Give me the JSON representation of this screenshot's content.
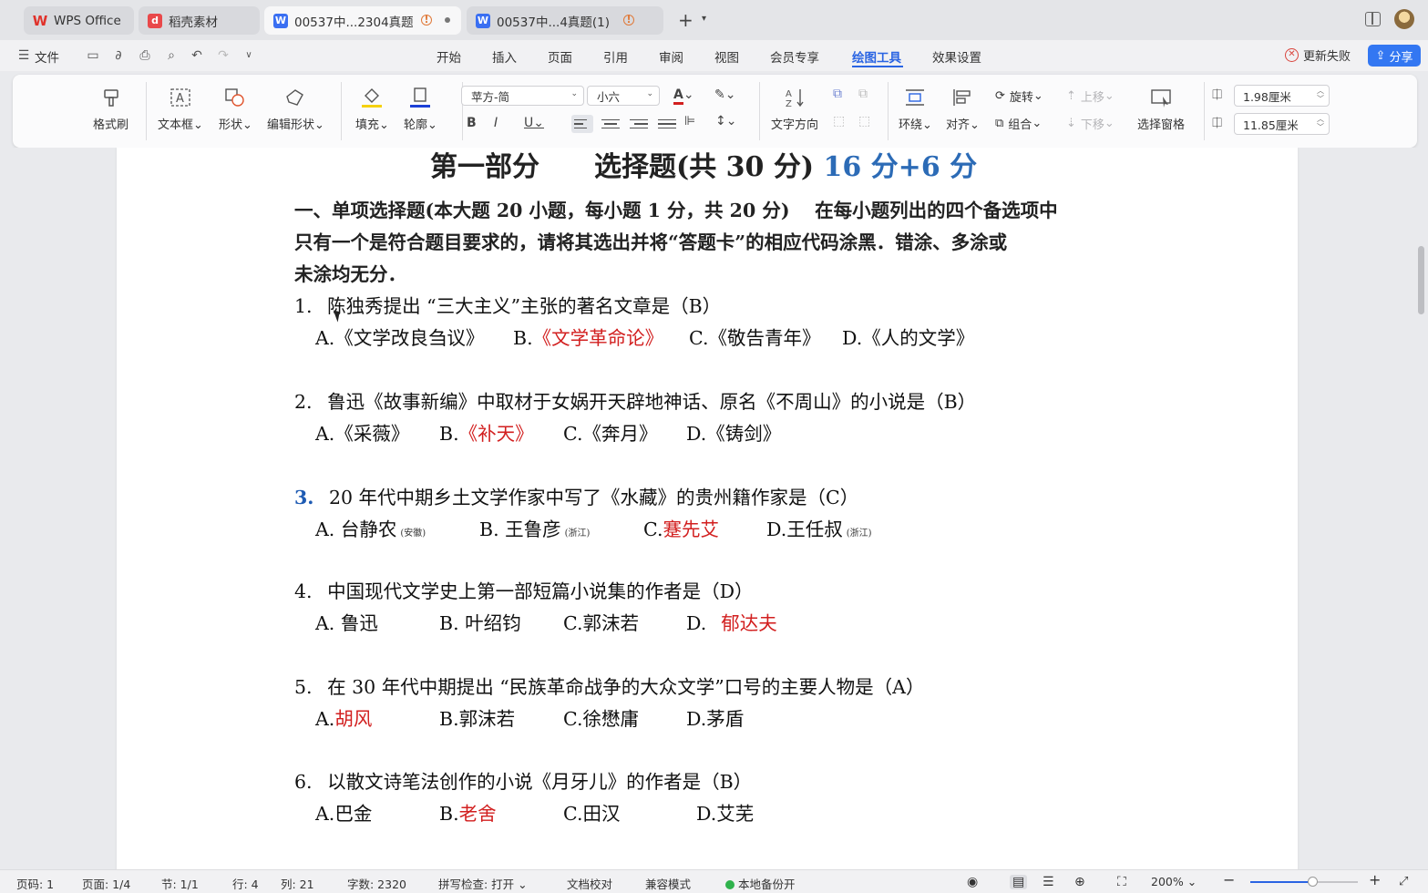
{
  "tabs": [
    {
      "label": "WPS Office",
      "icon": "wps-logo-icon",
      "active": false
    },
    {
      "label": "稻壳素材",
      "icon": "daoke-icon",
      "active": false
    },
    {
      "label": "00537中...2304真题",
      "icon": "word-doc-icon",
      "active": true
    },
    {
      "label": "00537中...4真题(1)",
      "icon": "word-doc-icon",
      "active": false
    }
  ],
  "menubar": {
    "file": "文件",
    "items": [
      "开始",
      "插入",
      "页面",
      "引用",
      "审阅",
      "视图",
      "会员专享",
      "绘图工具",
      "效果设置"
    ],
    "active": "绘图工具",
    "update_status": "更新失败",
    "share": "分享"
  },
  "ribbon": {
    "format_painter": "格式刷",
    "textbox": "文本框",
    "shape": "形状",
    "edit_shape": "编辑形状",
    "fill": "填充",
    "outline": "轮廓",
    "font_name": "苹方-简",
    "font_size": "小六",
    "text_direction": "文字方向",
    "wrap": "环绕",
    "align": "对齐",
    "rotate": "旋转",
    "group": "组合",
    "move_up": "上移",
    "move_down": "下移",
    "selection_pane": "选择窗格",
    "width": "1.98厘米",
    "height": "11.85厘米",
    "colors": {
      "fill_swatch": "#f5d10f",
      "outline_swatch": "#1b3fd6",
      "font_color_swatch": "#d21f1f"
    }
  },
  "document": {
    "heading": {
      "main": "第一部分　　选择题(共 30 分)",
      "extra": "16 分+6 分"
    },
    "instructions": [
      "一、单项选择题(本大题 20 小题，每小题 1 分，共 20 分)　 在每小题列出的四个备选项中",
      "只有一个是符合题目要求的，请将其选出并将“答题卡”的相应代码涂黑．错涂、多涂或",
      "未涂均无分．"
    ],
    "questions": [
      {
        "num": "1.",
        "text": "陈独秀提出 “三大主义”主张的著名文章是（B）",
        "options": [
          {
            "label": "A.《文学改良刍议》",
            "correct": false
          },
          {
            "label": "B.",
            "text": "《文学革命论》",
            "correct": true
          },
          {
            "label": "C.《敬告青年》",
            "correct": false
          },
          {
            "label": "D.《人的文学》",
            "correct": false
          }
        ]
      },
      {
        "num": "2.",
        "text": "鲁迅《故事新编》中取材于女娲开天辟地神话、原名《不周山》的小说是（B）",
        "options": [
          {
            "label": "A.《采薇》",
            "correct": false
          },
          {
            "label": "B.",
            "text": "《补天》",
            "correct": true
          },
          {
            "label": "C.《奔月》",
            "correct": false
          },
          {
            "label": "D.《铸剑》",
            "correct": false
          }
        ]
      },
      {
        "num": "3.",
        "text": "20 年代中期乡土文学作家中写了《水藏》的贵州籍作家是（C）",
        "options": [
          {
            "label": "A.  台静农",
            "note": "(安徽)",
            "correct": false
          },
          {
            "label": "B.  王鲁彦",
            "note": "(浙江)",
            "correct": false
          },
          {
            "label": "C.",
            "text": "蹇先艾",
            "correct": true
          },
          {
            "label": "D.王任叔",
            "note": "(浙江)",
            "correct": false
          }
        ]
      },
      {
        "num": "4.",
        "text": "中国现代文学史上第一部短篇小说集的作者是（D）",
        "options": [
          {
            "label": "A.  鲁迅",
            "correct": false
          },
          {
            "label": "B.  叶绍钧",
            "correct": false
          },
          {
            "label": "C.郭沫若",
            "correct": false
          },
          {
            "label": "D.",
            "text": "郁达夫",
            "correct": true
          }
        ]
      },
      {
        "num": "5.",
        "text": "在 30 年代中期提出 “民族革命战争的大众文学”口号的主要人物是（A）",
        "options": [
          {
            "label": "A.",
            "text": "胡风",
            "correct": true
          },
          {
            "label": "B.郭沫若",
            "correct": false
          },
          {
            "label": "C.徐懋庸",
            "correct": false
          },
          {
            "label": "D.茅盾",
            "correct": false
          }
        ]
      },
      {
        "num": "6.",
        "text": "以散文诗笔法创作的小说《月牙儿》的作者是（B）",
        "options": [
          {
            "label": "A.巴金",
            "correct": false
          },
          {
            "label": "B.",
            "text": "老舍",
            "correct": true
          },
          {
            "label": "C.田汉",
            "correct": false
          },
          {
            "label": "D.艾芜",
            "correct": false
          }
        ]
      }
    ]
  },
  "statusbar": {
    "page_code": "页码: 1",
    "page": "页面: 1/4",
    "section": "节: 1/1",
    "row": "行: 4",
    "col": "列: 21",
    "word_count": "字数: 2320",
    "spellcheck": "拼写检查: 打开",
    "proofread": "文档校对",
    "compat": "兼容模式",
    "backup": "本地备份开",
    "zoom": "200%",
    "zoom_level": 0.58
  }
}
